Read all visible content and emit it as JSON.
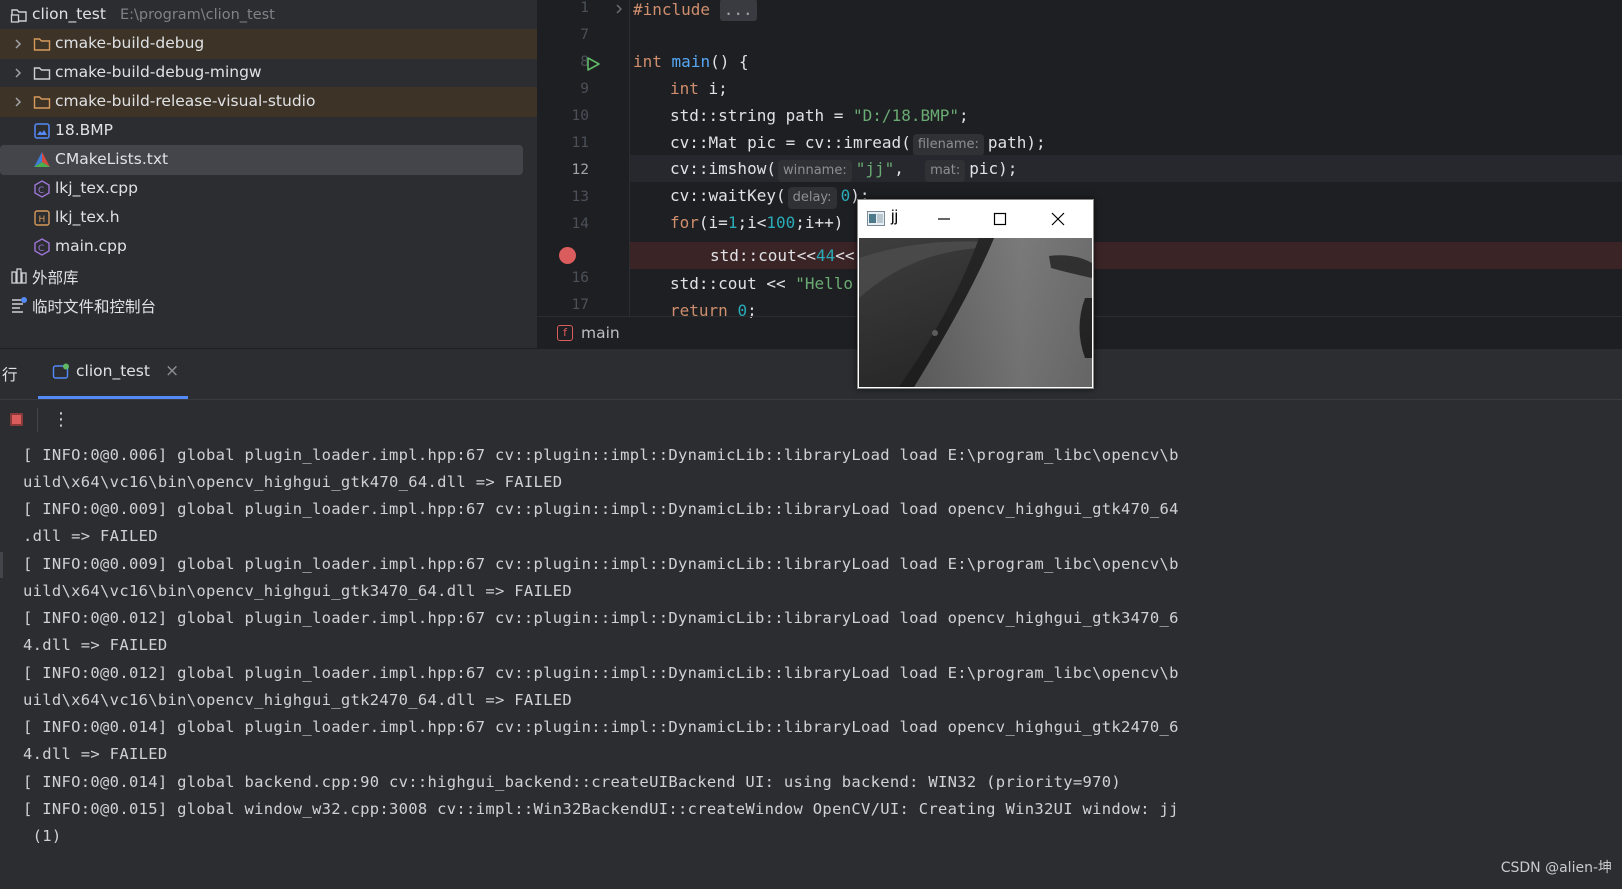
{
  "project": {
    "name": "clion_test",
    "path": "E:\\program\\clion_test",
    "items": [
      {
        "label": "cmake-build-debug",
        "icon": "folder-icon",
        "expandable": true,
        "excluded": true
      },
      {
        "label": "cmake-build-debug-mingw",
        "icon": "folder-icon",
        "expandable": true,
        "excluded": false
      },
      {
        "label": "cmake-build-release-visual-studio",
        "icon": "folder-icon",
        "expandable": true,
        "excluded": true
      },
      {
        "label": "18.BMP",
        "icon": "image-file-icon"
      },
      {
        "label": "CMakeLists.txt",
        "icon": "cmake-file-icon",
        "selected": true
      },
      {
        "label": "lkj_tex.cpp",
        "icon": "cpp-file-icon"
      },
      {
        "label": "lkj_tex.h",
        "icon": "header-file-icon"
      },
      {
        "label": "main.cpp",
        "icon": "cpp-file-icon"
      }
    ],
    "external_libs": "外部库",
    "scratches": "临时文件和控制台"
  },
  "editor": {
    "line_numbers": [
      "1",
      "7",
      "8",
      "9",
      "10",
      "11",
      "12",
      "13",
      "14",
      "",
      "16",
      "17"
    ],
    "current_line": "12",
    "code": {
      "l1_kw": "#include",
      "l1_fold": "...",
      "l8_kw": "int",
      "l8_fn": "main",
      "l8_rest": "() {",
      "l9_kw": "int",
      "l9_rest": " i;",
      "l10_pre": "std::string path = ",
      "l10_str": "\"D:/18.BMP\"",
      "l10_post": ";",
      "l11_pre": "cv::Mat pic = cv::imread(",
      "l11_hint": "filename:",
      "l11_post": "path);",
      "l12_pre": "cv::imshow(",
      "l12_hint1": "winname:",
      "l12_str": "\"jj\"",
      "l12_mid": ",  ",
      "l12_hint2": "mat:",
      "l12_post": "pic);",
      "l13_pre": "cv::waitKey(",
      "l13_hint": "delay:",
      "l13_num": "0",
      "l13_post": ");",
      "l14_kw": "for",
      "l14_a": "(i=",
      "l14_n1": "1",
      "l14_b": ";i<",
      "l14_n2": "100",
      "l14_c": ";i++)",
      "l15_pre": "std::cout<<",
      "l15_num": "44",
      "l15_post": "<<",
      "l16_pre": "std::cout << ",
      "l16_str": "\"Hello",
      "l17_kw": "return",
      "l17_num": "0",
      "l17_post": ";"
    },
    "breadcrumb": "main",
    "breadcrumb_badge": "f"
  },
  "run_panel": {
    "side_label": "行",
    "tab_label": "clion_test",
    "tab_close": "×",
    "menu_dots": "⋮",
    "console_lines": [
      "[ INFO:0@0.006] global plugin_loader.impl.hpp:67 cv::plugin::impl::DynamicLib::libraryLoad load E:\\program_libc\\opencv\\b",
      "uild\\x64\\vc16\\bin\\opencv_highgui_gtk470_64.dll => FAILED",
      "[ INFO:0@0.009] global plugin_loader.impl.hpp:67 cv::plugin::impl::DynamicLib::libraryLoad load opencv_highgui_gtk470_64",
      ".dll => FAILED",
      "[ INFO:0@0.009] global plugin_loader.impl.hpp:67 cv::plugin::impl::DynamicLib::libraryLoad load E:\\program_libc\\opencv\\b",
      "uild\\x64\\vc16\\bin\\opencv_highgui_gtk3470_64.dll => FAILED",
      "[ INFO:0@0.012] global plugin_loader.impl.hpp:67 cv::plugin::impl::DynamicLib::libraryLoad load opencv_highgui_gtk3470_6",
      "4.dll => FAILED",
      "[ INFO:0@0.012] global plugin_loader.impl.hpp:67 cv::plugin::impl::DynamicLib::libraryLoad load E:\\program_libc\\opencv\\b",
      "uild\\x64\\vc16\\bin\\opencv_highgui_gtk2470_64.dll => FAILED",
      "[ INFO:0@0.014] global plugin_loader.impl.hpp:67 cv::plugin::impl::DynamicLib::libraryLoad load opencv_highgui_gtk2470_6",
      "4.dll => FAILED",
      "[ INFO:0@0.014] global backend.cpp:90 cv::highgui_backend::createUIBackend UI: using backend: WIN32 (priority=970)",
      "[ INFO:0@0.015] global window_w32.cpp:3008 cv::impl::Win32BackendUI::createWindow OpenCV/UI: Creating Win32UI window: jj",
      " (1)"
    ]
  },
  "cv_window": {
    "title": "jj"
  },
  "watermark": "CSDN @alien-坤",
  "colors": {
    "excluded_folder_bg": "#3d3326",
    "selection_bg": "#43454a",
    "breakpoint_line_bg": "#3b2426",
    "breakpoint": "#db5c5c",
    "keyword": "#cf8e6d",
    "function": "#56a8f5",
    "string": "#6aab73",
    "number": "#2aacb8",
    "stop_button": "#db5c5c"
  }
}
